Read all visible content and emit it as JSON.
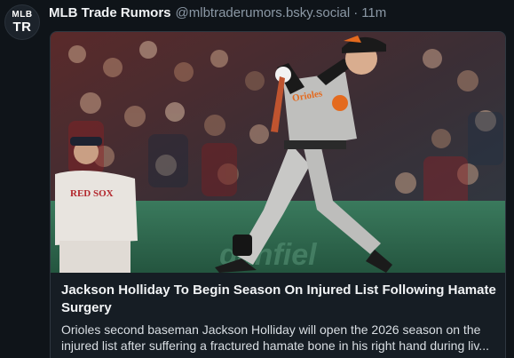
{
  "author": {
    "avatar_line1": "MLB",
    "avatar_line2": "TR",
    "name": "MLB Trade Rumors",
    "handle": "@mlbtraderumors.bsky.social",
    "separator": "·",
    "time": "11m"
  },
  "card": {
    "image_icon": "baseball-player-photo",
    "title": "Jackson Holliday To Begin Season On Injured List Following Hamate Surgery",
    "description_line1": "Orioles second baseman Jackson Holliday will open the 2026 season on the",
    "description_line2": "injured list after suffering a fractured hamate bone in his right hand during liv..."
  },
  "colors": {
    "background": "#0f1419",
    "card_border": "#2f3740",
    "muted_text": "#8b98a5",
    "wall_green": "#2e6b4f"
  }
}
